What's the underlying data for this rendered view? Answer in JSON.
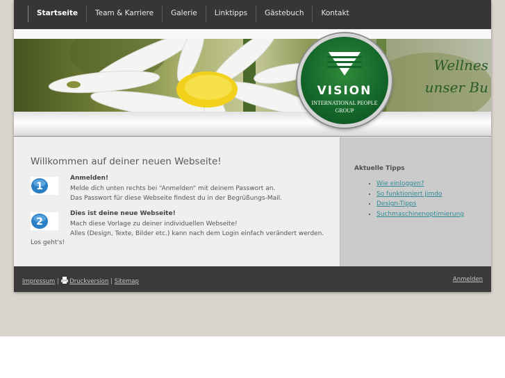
{
  "nav": {
    "items": [
      {
        "label": "Startseite",
        "active": true
      },
      {
        "label": "Team & Karriere"
      },
      {
        "label": "Galerie"
      },
      {
        "label": "Linktipps"
      },
      {
        "label": "Gästebuch"
      },
      {
        "label": "Kontakt"
      }
    ]
  },
  "header": {
    "banner_line1": "Wellnes",
    "banner_line2": "unser Bu",
    "logo": {
      "brand": "VISION",
      "line1": "INTERNATIONAL PEOPLE",
      "line2": "GROUP"
    }
  },
  "main": {
    "title": "Willkommen auf deiner neuen Webseite!",
    "steps": [
      {
        "icon": "number-1-icon",
        "heading": "Anmelden!",
        "line1": "Melde dich unten rechts bei “Anmelden“ mit deinem Passwort an.",
        "line2": "Das Passwort für diese Webseite findest du in der Begrüßungs-Mail."
      },
      {
        "icon": "number-2-icon",
        "heading": "Dies ist deine neue Webseite!",
        "line1": "Mach diese Vorlage zu deiner individuellen Webseite!",
        "line2": "Alles (Design, Texte, Bilder etc.) kann nach dem Login einfach verändert werden."
      }
    ],
    "closing": "Los geht's!"
  },
  "sidebar": {
    "title": "Aktuelle Tipps",
    "tips": [
      "Wie einloggen?",
      "So funktioniert Jimdo",
      "Design-Tipps",
      "Suchmaschinenoptimierung"
    ]
  },
  "footer": {
    "impressum": "Impressum",
    "separator": "|",
    "druckversion": "Druckversion",
    "sitemap": "Sitemap",
    "login": "Anmelden"
  },
  "colors": {
    "nav_bg": "#363636",
    "link": "#2e8b96",
    "logo_green": "#14652a",
    "footer_bg": "#3a3a3a"
  }
}
